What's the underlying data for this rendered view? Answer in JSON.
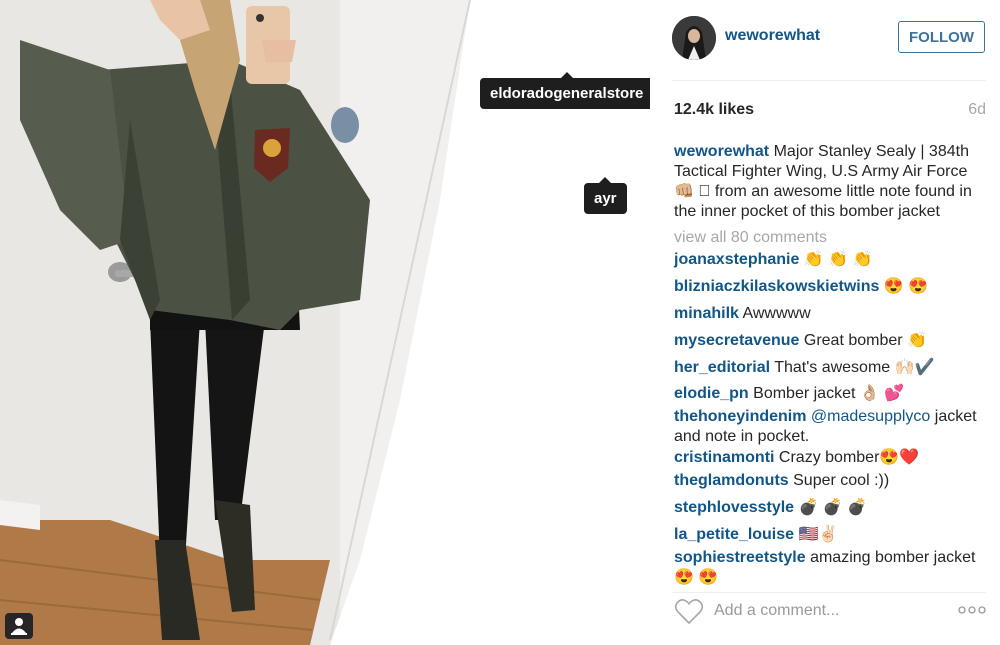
{
  "photo": {
    "tags": [
      {
        "label": "eldoradogeneralstore"
      },
      {
        "label": "ayr"
      }
    ]
  },
  "post": {
    "author": "weworewhat",
    "follow_label": "FOLLOW",
    "likes": "12.4k likes",
    "age": "6d",
    "caption": {
      "username": "weworewhat",
      "text": "Major Stanley Sealy | 384th Tactical Fighter Wing, U.S Army Air Force 👊🏼 ⃞ from an awesome little note found in the inner pocket of this bomber jacket"
    },
    "view_all": "view all 80 comments",
    "comments": [
      {
        "user": "joanaxstephanie",
        "text": "👏 👏 👏"
      },
      {
        "user": "blizniaczkilaskowskietwins",
        "text": "😍 😍"
      },
      {
        "user": "minahilk",
        "text": "Awwwww"
      },
      {
        "user": "mysecretavenue",
        "text": "Great bomber 👏"
      },
      {
        "user": "her_editorial",
        "text": "That's awesome 🙌🏻✔️"
      },
      {
        "user": "elodie_pn",
        "text": "Bomber jacket 👌🏼 💕"
      },
      {
        "user": "thehoneyindenim",
        "mention": "@madesupplyco",
        "text": "jacket and note in pocket."
      },
      {
        "user": "cristinamonti",
        "text": "Crazy bomber😍❤️"
      },
      {
        "user": "theglamdonuts",
        "text": "Super cool :))"
      },
      {
        "user": "stephlovesstyle",
        "text": "💣 💣 💣"
      },
      {
        "user": "la_petite_louise",
        "text": "🇺🇸✌🏻"
      },
      {
        "user": "sophiestreetstyle",
        "text": "amazing bomber jacket 😍 😍"
      }
    ],
    "add_comment_placeholder": "Add a comment...",
    "icons": {
      "like": "heart-outline-icon",
      "more": "more-options-icon",
      "user_tag": "user-tag-icon"
    },
    "colors": {
      "username": "#125688",
      "follow": "#3f729b",
      "muted": "#a5a7aa"
    }
  }
}
